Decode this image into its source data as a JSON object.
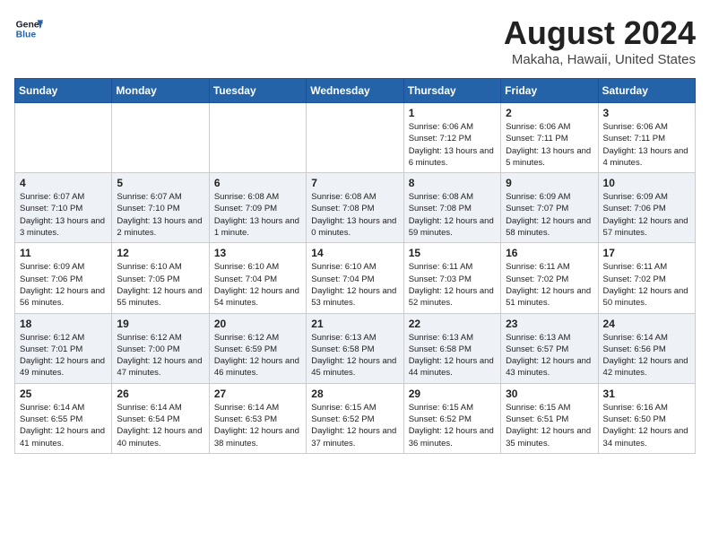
{
  "header": {
    "logo_line1": "General",
    "logo_line2": "Blue",
    "month": "August 2024",
    "location": "Makaha, Hawaii, United States"
  },
  "weekdays": [
    "Sunday",
    "Monday",
    "Tuesday",
    "Wednesday",
    "Thursday",
    "Friday",
    "Saturday"
  ],
  "weeks": [
    [
      {
        "day": "",
        "sunrise": "",
        "sunset": "",
        "daylight": ""
      },
      {
        "day": "",
        "sunrise": "",
        "sunset": "",
        "daylight": ""
      },
      {
        "day": "",
        "sunrise": "",
        "sunset": "",
        "daylight": ""
      },
      {
        "day": "",
        "sunrise": "",
        "sunset": "",
        "daylight": ""
      },
      {
        "day": "1",
        "sunrise": "Sunrise: 6:06 AM",
        "sunset": "Sunset: 7:12 PM",
        "daylight": "Daylight: 13 hours and 6 minutes."
      },
      {
        "day": "2",
        "sunrise": "Sunrise: 6:06 AM",
        "sunset": "Sunset: 7:11 PM",
        "daylight": "Daylight: 13 hours and 5 minutes."
      },
      {
        "day": "3",
        "sunrise": "Sunrise: 6:06 AM",
        "sunset": "Sunset: 7:11 PM",
        "daylight": "Daylight: 13 hours and 4 minutes."
      }
    ],
    [
      {
        "day": "4",
        "sunrise": "Sunrise: 6:07 AM",
        "sunset": "Sunset: 7:10 PM",
        "daylight": "Daylight: 13 hours and 3 minutes."
      },
      {
        "day": "5",
        "sunrise": "Sunrise: 6:07 AM",
        "sunset": "Sunset: 7:10 PM",
        "daylight": "Daylight: 13 hours and 2 minutes."
      },
      {
        "day": "6",
        "sunrise": "Sunrise: 6:08 AM",
        "sunset": "Sunset: 7:09 PM",
        "daylight": "Daylight: 13 hours and 1 minute."
      },
      {
        "day": "7",
        "sunrise": "Sunrise: 6:08 AM",
        "sunset": "Sunset: 7:08 PM",
        "daylight": "Daylight: 13 hours and 0 minutes."
      },
      {
        "day": "8",
        "sunrise": "Sunrise: 6:08 AM",
        "sunset": "Sunset: 7:08 PM",
        "daylight": "Daylight: 12 hours and 59 minutes."
      },
      {
        "day": "9",
        "sunrise": "Sunrise: 6:09 AM",
        "sunset": "Sunset: 7:07 PM",
        "daylight": "Daylight: 12 hours and 58 minutes."
      },
      {
        "day": "10",
        "sunrise": "Sunrise: 6:09 AM",
        "sunset": "Sunset: 7:06 PM",
        "daylight": "Daylight: 12 hours and 57 minutes."
      }
    ],
    [
      {
        "day": "11",
        "sunrise": "Sunrise: 6:09 AM",
        "sunset": "Sunset: 7:06 PM",
        "daylight": "Daylight: 12 hours and 56 minutes."
      },
      {
        "day": "12",
        "sunrise": "Sunrise: 6:10 AM",
        "sunset": "Sunset: 7:05 PM",
        "daylight": "Daylight: 12 hours and 55 minutes."
      },
      {
        "day": "13",
        "sunrise": "Sunrise: 6:10 AM",
        "sunset": "Sunset: 7:04 PM",
        "daylight": "Daylight: 12 hours and 54 minutes."
      },
      {
        "day": "14",
        "sunrise": "Sunrise: 6:10 AM",
        "sunset": "Sunset: 7:04 PM",
        "daylight": "Daylight: 12 hours and 53 minutes."
      },
      {
        "day": "15",
        "sunrise": "Sunrise: 6:11 AM",
        "sunset": "Sunset: 7:03 PM",
        "daylight": "Daylight: 12 hours and 52 minutes."
      },
      {
        "day": "16",
        "sunrise": "Sunrise: 6:11 AM",
        "sunset": "Sunset: 7:02 PM",
        "daylight": "Daylight: 12 hours and 51 minutes."
      },
      {
        "day": "17",
        "sunrise": "Sunrise: 6:11 AM",
        "sunset": "Sunset: 7:02 PM",
        "daylight": "Daylight: 12 hours and 50 minutes."
      }
    ],
    [
      {
        "day": "18",
        "sunrise": "Sunrise: 6:12 AM",
        "sunset": "Sunset: 7:01 PM",
        "daylight": "Daylight: 12 hours and 49 minutes."
      },
      {
        "day": "19",
        "sunrise": "Sunrise: 6:12 AM",
        "sunset": "Sunset: 7:00 PM",
        "daylight": "Daylight: 12 hours and 47 minutes."
      },
      {
        "day": "20",
        "sunrise": "Sunrise: 6:12 AM",
        "sunset": "Sunset: 6:59 PM",
        "daylight": "Daylight: 12 hours and 46 minutes."
      },
      {
        "day": "21",
        "sunrise": "Sunrise: 6:13 AM",
        "sunset": "Sunset: 6:58 PM",
        "daylight": "Daylight: 12 hours and 45 minutes."
      },
      {
        "day": "22",
        "sunrise": "Sunrise: 6:13 AM",
        "sunset": "Sunset: 6:58 PM",
        "daylight": "Daylight: 12 hours and 44 minutes."
      },
      {
        "day": "23",
        "sunrise": "Sunrise: 6:13 AM",
        "sunset": "Sunset: 6:57 PM",
        "daylight": "Daylight: 12 hours and 43 minutes."
      },
      {
        "day": "24",
        "sunrise": "Sunrise: 6:14 AM",
        "sunset": "Sunset: 6:56 PM",
        "daylight": "Daylight: 12 hours and 42 minutes."
      }
    ],
    [
      {
        "day": "25",
        "sunrise": "Sunrise: 6:14 AM",
        "sunset": "Sunset: 6:55 PM",
        "daylight": "Daylight: 12 hours and 41 minutes."
      },
      {
        "day": "26",
        "sunrise": "Sunrise: 6:14 AM",
        "sunset": "Sunset: 6:54 PM",
        "daylight": "Daylight: 12 hours and 40 minutes."
      },
      {
        "day": "27",
        "sunrise": "Sunrise: 6:14 AM",
        "sunset": "Sunset: 6:53 PM",
        "daylight": "Daylight: 12 hours and 38 minutes."
      },
      {
        "day": "28",
        "sunrise": "Sunrise: 6:15 AM",
        "sunset": "Sunset: 6:52 PM",
        "daylight": "Daylight: 12 hours and 37 minutes."
      },
      {
        "day": "29",
        "sunrise": "Sunrise: 6:15 AM",
        "sunset": "Sunset: 6:52 PM",
        "daylight": "Daylight: 12 hours and 36 minutes."
      },
      {
        "day": "30",
        "sunrise": "Sunrise: 6:15 AM",
        "sunset": "Sunset: 6:51 PM",
        "daylight": "Daylight: 12 hours and 35 minutes."
      },
      {
        "day": "31",
        "sunrise": "Sunrise: 6:16 AM",
        "sunset": "Sunset: 6:50 PM",
        "daylight": "Daylight: 12 hours and 34 minutes."
      }
    ]
  ]
}
